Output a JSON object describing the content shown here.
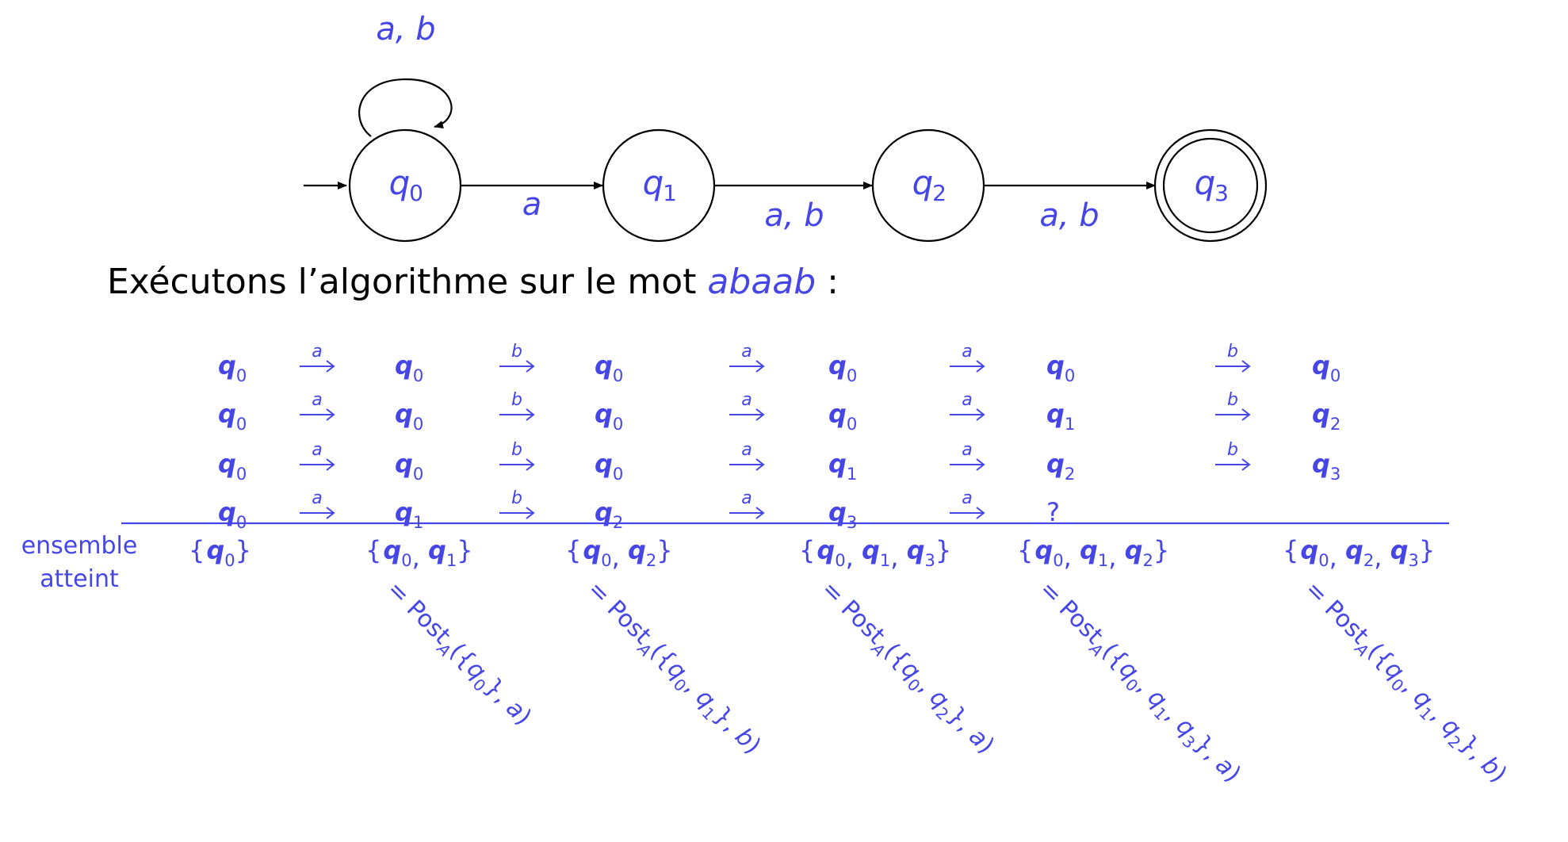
{
  "automaton": {
    "states": [
      {
        "id": "q0",
        "base": "q",
        "sub": "0",
        "accepting": false,
        "initial": true
      },
      {
        "id": "q1",
        "base": "q",
        "sub": "1",
        "accepting": false,
        "initial": false
      },
      {
        "id": "q2",
        "base": "q",
        "sub": "2",
        "accepting": false,
        "initial": false
      },
      {
        "id": "q3",
        "base": "q",
        "sub": "3",
        "accepting": true,
        "initial": false
      }
    ],
    "transitions": [
      {
        "from": "q0",
        "to": "q0",
        "label": "a, b"
      },
      {
        "from": "q0",
        "to": "q1",
        "label": "a"
      },
      {
        "from": "q1",
        "to": "q2",
        "label": "a, b"
      },
      {
        "from": "q2",
        "to": "q3",
        "label": "a, b"
      }
    ]
  },
  "sentence": {
    "before": "Exécutons l’algorithme sur le mot ",
    "word": "abaab",
    "after": " :"
  },
  "trace": {
    "letters": [
      "a",
      "b",
      "a",
      "a",
      "b"
    ],
    "rows": [
      [
        "q0",
        "q0",
        "q0",
        "q0",
        "q0",
        "q0"
      ],
      [
        "q0",
        "q0",
        "q0",
        "q0",
        "q1",
        "q2"
      ],
      [
        "q0",
        "q0",
        "q0",
        "q1",
        "q2",
        "q3"
      ],
      [
        "q0",
        "q1",
        "q2",
        "q3",
        "?",
        ""
      ]
    ],
    "row_label_lines": [
      "ensemble",
      "atteint"
    ],
    "sets": [
      [
        "q0"
      ],
      [
        "q0",
        "q1"
      ],
      [
        "q0",
        "q2"
      ],
      [
        "q0",
        "q1",
        "q3"
      ],
      [
        "q0",
        "q1",
        "q2"
      ],
      [
        "q0",
        "q2",
        "q3"
      ]
    ],
    "post_annotations": [
      {
        "set": [
          "q0"
        ],
        "letter": "a"
      },
      {
        "set": [
          "q0",
          "q1"
        ],
        "letter": "b"
      },
      {
        "set": [
          "q0",
          "q2"
        ],
        "letter": "a"
      },
      {
        "set": [
          "q0",
          "q1",
          "q3"
        ],
        "letter": "a"
      },
      {
        "set": [
          "q0",
          "q1",
          "q2"
        ],
        "letter": "b"
      }
    ],
    "post_prefix": "= Post",
    "post_sub": "A"
  },
  "colors": {
    "accent": "#4646e6",
    "ink": "#000000",
    "background": "#ffffff"
  }
}
